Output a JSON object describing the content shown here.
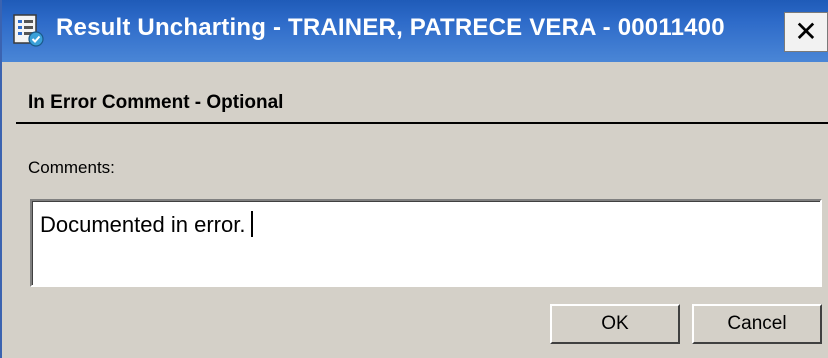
{
  "window": {
    "title": "Result Uncharting - TRAINER, PATRECE VERA - 00011400",
    "close_label": "✕",
    "app_icon": "document-check-icon"
  },
  "section": {
    "title": "In Error Comment - Optional"
  },
  "comments": {
    "label": "Comments:",
    "value": "Documented in error."
  },
  "buttons": {
    "ok_label": "OK",
    "cancel_label": "Cancel"
  },
  "colors": {
    "titlebar": "#2e6bc9",
    "dialog_bg": "#d4d0c8"
  }
}
